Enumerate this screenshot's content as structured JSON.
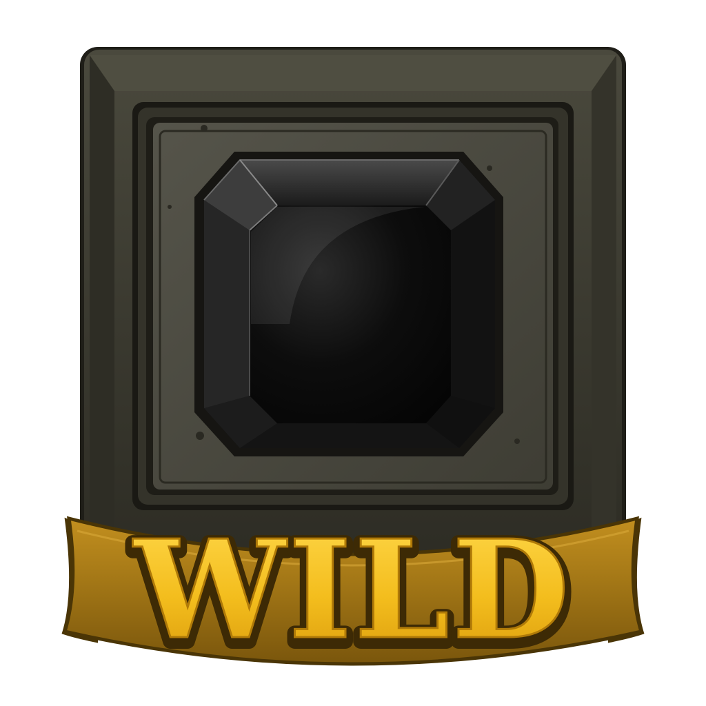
{
  "symbol": {
    "label": "WILD",
    "gem_icon": "black-octagon-gem-icon",
    "colors": {
      "stone": "#3b3a30",
      "stone_dark": "#24231c",
      "stone_light": "#5a5849",
      "gem": "#0b0b0b",
      "banner": "#a27616",
      "banner_dark": "#6e4e0a",
      "text_fill": "#f5c320",
      "text_outline": "#3d2a05"
    }
  }
}
